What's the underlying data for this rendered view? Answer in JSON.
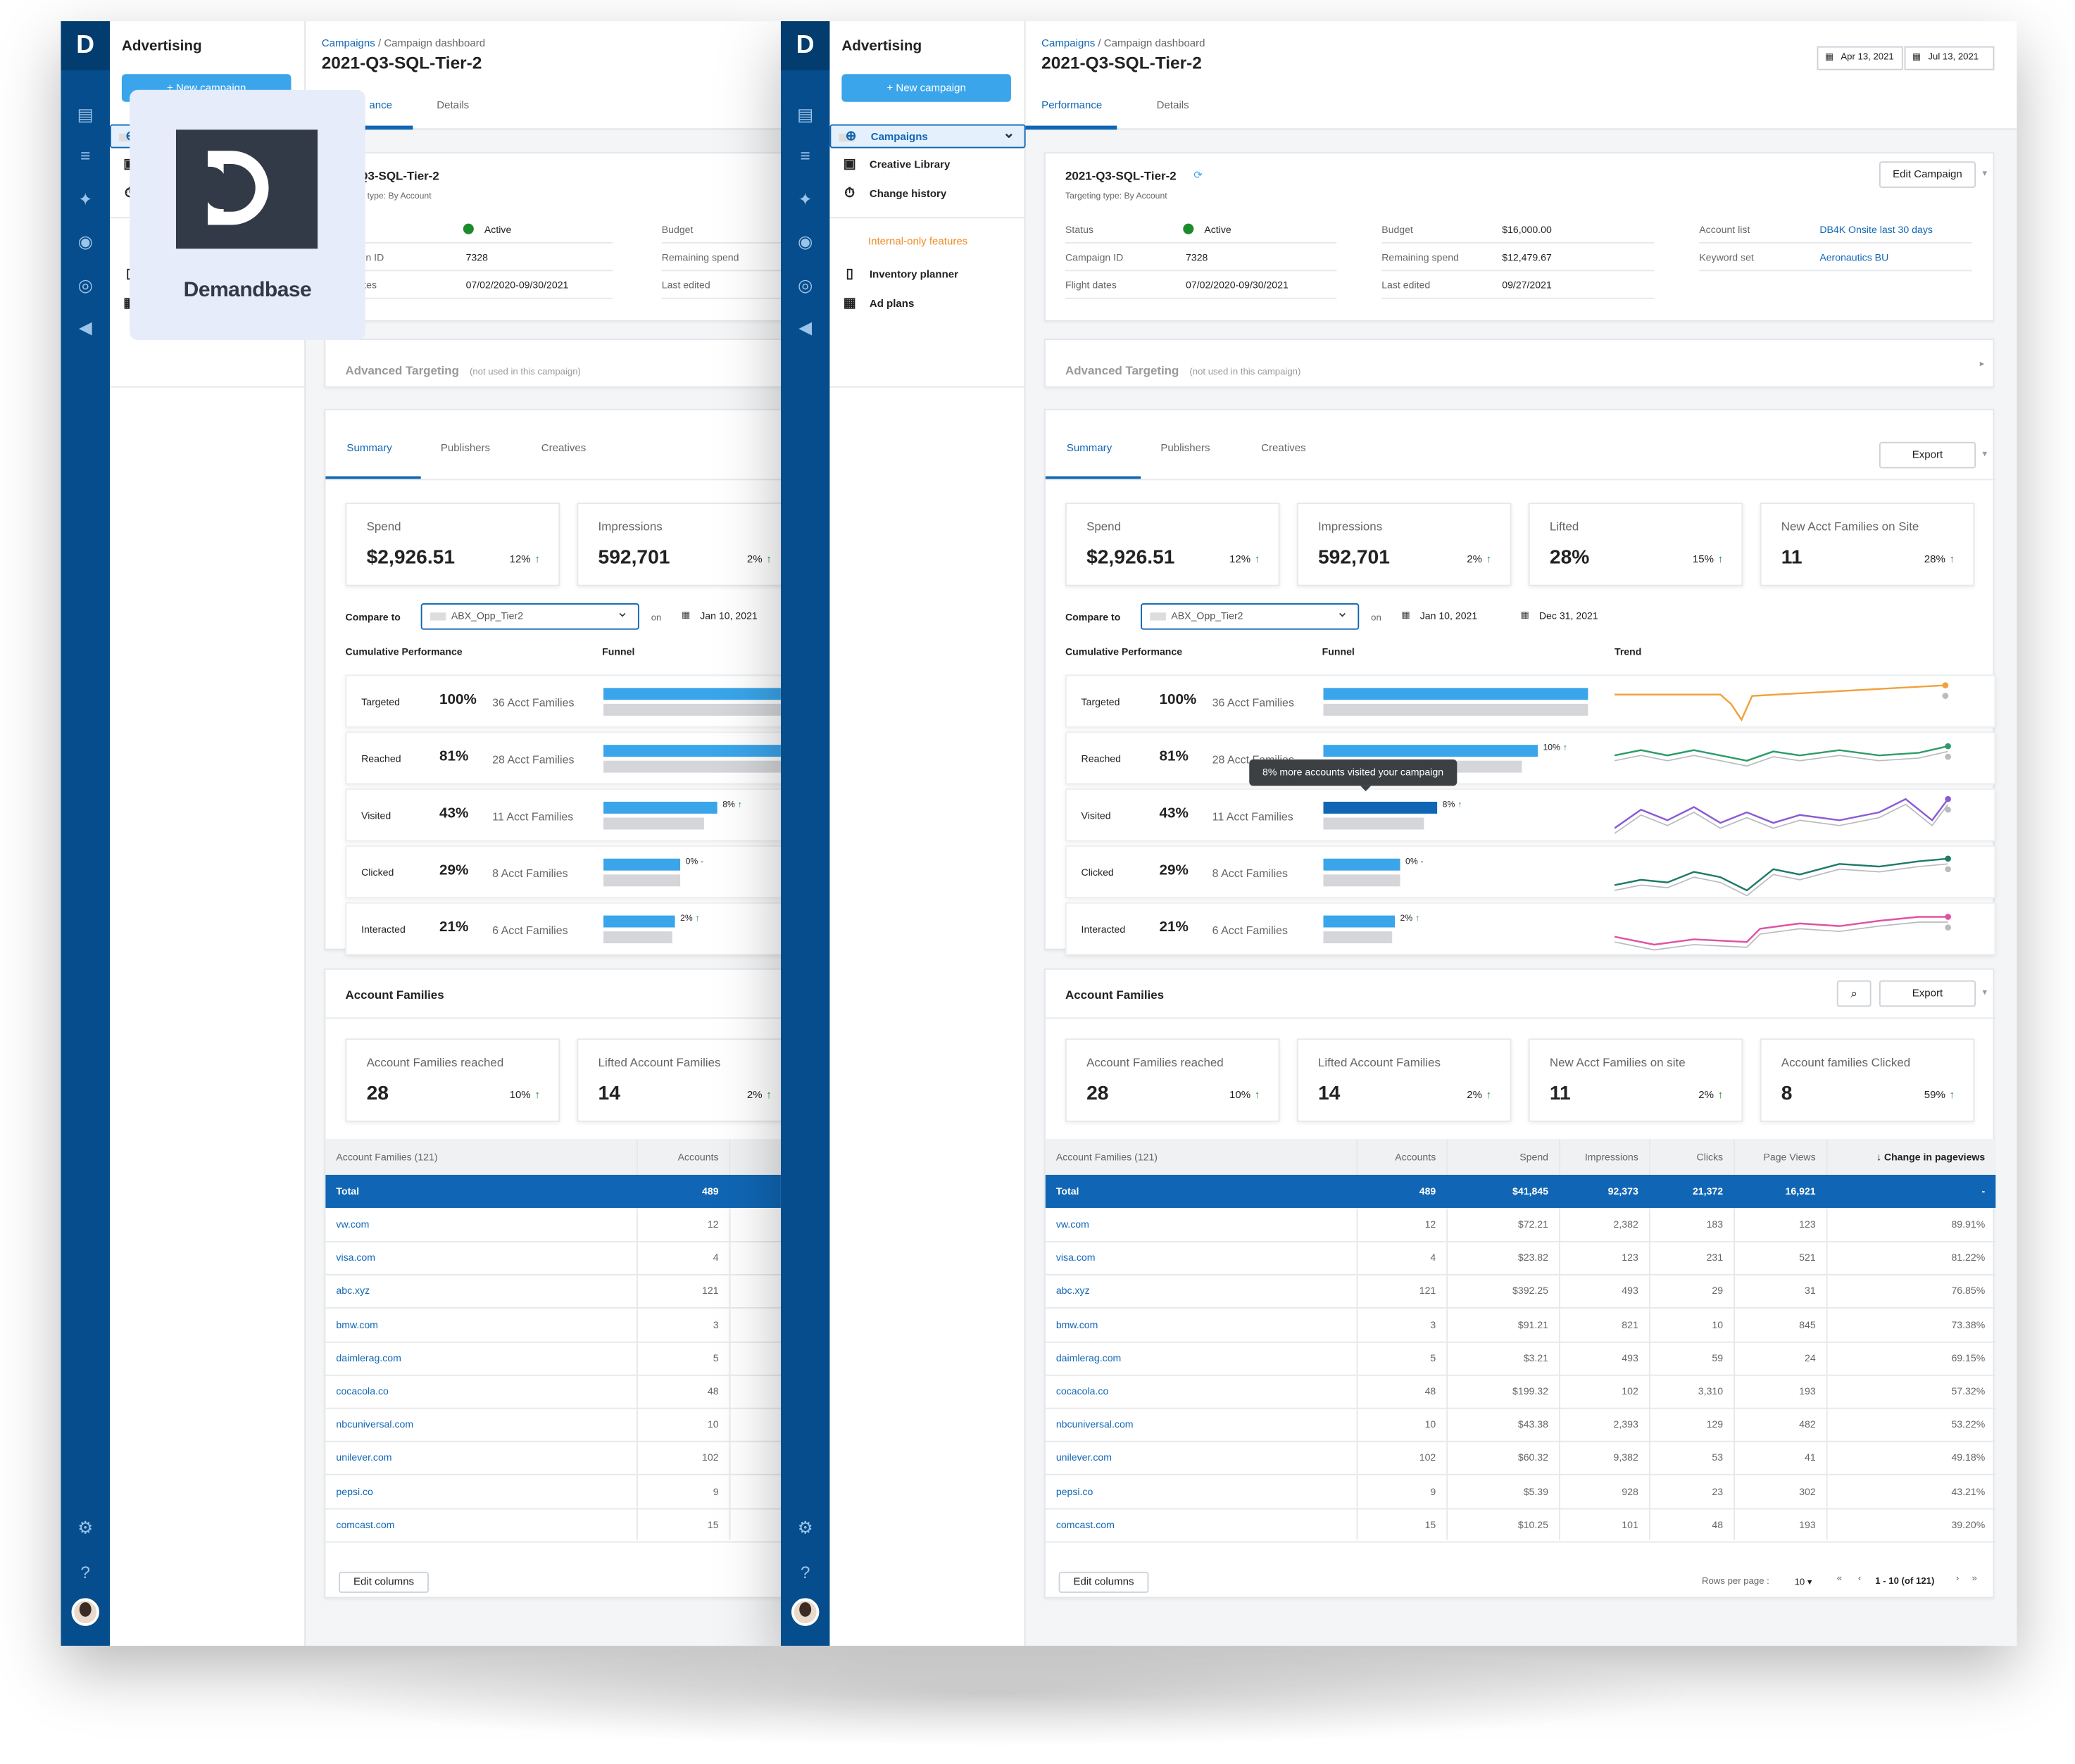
{
  "app": {
    "section": "Advertising",
    "new_campaign": "+ New campaign",
    "logo_letter": "D"
  },
  "brand": {
    "wordmark": "Demandbase"
  },
  "nav": {
    "items": [
      {
        "label": "Campaigns",
        "icon": "crosshair-icon"
      },
      {
        "label": "Creative Library",
        "icon": "library-icon"
      },
      {
        "label": "Change history",
        "icon": "stopwatch-icon"
      }
    ],
    "internal_label": "Internal-only features",
    "internal_items": [
      {
        "label": "Inventory planner",
        "icon": "tablet-icon"
      },
      {
        "label": "Ad plans",
        "icon": "calendar-icon"
      }
    ]
  },
  "breadcrumb": {
    "root": "Campaigns",
    "sep": " / ",
    "current": "Campaign dashboard"
  },
  "page_title": "2021-Q3-SQL-Tier-2",
  "tabs": [
    "Performance",
    "Details"
  ],
  "tab_fragment": "ance",
  "date_range": {
    "start": "Apr 13, 2021",
    "end": "Jul 13, 2021"
  },
  "campaign": {
    "name": "2021-Q3-SQL-Tier-2",
    "targeting": "Targeting type: By Account",
    "edit": "Edit Campaign",
    "fields": {
      "status_label": "Status",
      "status": "Active",
      "id_label": "Campaign ID",
      "id": "7328",
      "flight_label": "Flight dates",
      "flight": "07/02/2020-09/30/2021",
      "budget_label": "Budget",
      "budget": "$16,000.00",
      "remaining_label": "Remaining spend",
      "remaining": "$12,479.67",
      "edited_label": "Last edited",
      "edited": "09/27/2021",
      "account_list_label": "Account list",
      "account_list": "DB4K Onsite last 30 days",
      "keyword_label": "Keyword set",
      "keyword": "Aeronautics BU"
    },
    "crop": {
      "title": "21-Q3-SQL-Tier-2",
      "targeting": "geting type: By Account",
      "status": "us",
      "id": "npaign ID",
      "flight": "ht dates"
    }
  },
  "advanced": {
    "label": "Advanced Targeting",
    "note": "(not used in this campaign)"
  },
  "summary_tabs": [
    "Summary",
    "Publishers",
    "Creatives"
  ],
  "export": "Export",
  "kpis": [
    {
      "label": "Spend",
      "value": "$2,926.51",
      "change": "12%"
    },
    {
      "label": "Impressions",
      "value": "592,701",
      "change": "2%"
    },
    {
      "label": "Lifted",
      "value": "28%",
      "change": "15%"
    },
    {
      "label": "New Acct Families on Site",
      "value": "11",
      "change": "28%"
    }
  ],
  "compare": {
    "label": "Compare to",
    "segment": "ABX_Opp_Tier2",
    "on": "on",
    "date1": "Jan 10, 2021",
    "date2": "Dec 31, 2021"
  },
  "perf": {
    "headers": [
      "Cumulative Performance",
      "Funnel",
      "Trend"
    ],
    "tooltip": "8% more accounts visited your campaign",
    "rows": [
      {
        "name": "Targeted",
        "pct": "100%",
        "accts": "36 Acct Families",
        "fill": 1.0,
        "prev": 1.0,
        "delta": ""
      },
      {
        "name": "Reached",
        "pct": "81%",
        "accts": "28 Acct Families",
        "fill": 0.81,
        "prev": 0.75,
        "delta": "10%"
      },
      {
        "name": "Visited",
        "pct": "43%",
        "accts": "11 Acct Families",
        "fill": 0.43,
        "prev": 0.38,
        "delta": "8%"
      },
      {
        "name": "Clicked",
        "pct": "29%",
        "accts": "8 Acct Families",
        "fill": 0.29,
        "prev": 0.29,
        "delta": "0%"
      },
      {
        "name": "Interacted",
        "pct": "21%",
        "accts": "6 Acct Families",
        "fill": 0.27,
        "prev": 0.26,
        "delta": "2%"
      }
    ],
    "trend_colors": [
      "#f3a03b",
      "#2d9c6a",
      "#8a5ad6",
      "#1f7a6a",
      "#e052a6"
    ]
  },
  "af": {
    "title": "Account Families",
    "kpis": [
      {
        "label": "Account Families reached",
        "value": "28",
        "change": "10%"
      },
      {
        "label": "Lifted Account Families",
        "value": "14",
        "change": "2%"
      },
      {
        "label": "New Acct Families on site",
        "value": "11",
        "change": "2%"
      },
      {
        "label": "Account families Clicked",
        "value": "8",
        "change": "59%"
      }
    ],
    "columns": [
      "Account Families (121)",
      "Accounts",
      "Spend",
      "Impressions",
      "Clicks",
      "Page Views",
      "↓ Change in pageviews"
    ],
    "total": [
      "Total",
      "489",
      "$41,845",
      "92,373",
      "21,372",
      "16,921",
      "-"
    ],
    "rows": [
      [
        "vw.com",
        "12",
        "$72.21",
        "2,382",
        "183",
        "123",
        "89.91%"
      ],
      [
        "visa.com",
        "4",
        "$23.82",
        "123",
        "231",
        "521",
        "81.22%"
      ],
      [
        "abc.xyz",
        "121",
        "$392.25",
        "493",
        "29",
        "31",
        "76.85%"
      ],
      [
        "bmw.com",
        "3",
        "$91.21",
        "821",
        "10",
        "845",
        "73.38%"
      ],
      [
        "daimlerag.com",
        "5",
        "$3.21",
        "493",
        "59",
        "24",
        "69.15%"
      ],
      [
        "cocacola.co",
        "48",
        "$199.32",
        "102",
        "3,310",
        "193",
        "57.32%"
      ],
      [
        "nbcuniversal.com",
        "10",
        "$43.38",
        "2,393",
        "129",
        "482",
        "53.22%"
      ],
      [
        "unilever.com",
        "102",
        "$60.32",
        "9,382",
        "53",
        "41",
        "49.18%"
      ],
      [
        "pepsi.co",
        "9",
        "$5.39",
        "928",
        "23",
        "302",
        "43.21%"
      ],
      [
        "comcast.com",
        "15",
        "$10.25",
        "101",
        "48",
        "193",
        "39.20%"
      ]
    ],
    "edit_columns": "Edit columns",
    "rows_per_page_label": "Rows per page :",
    "rows_per_page": "10 ▾",
    "range": "1 - 10 (of 121)"
  }
}
